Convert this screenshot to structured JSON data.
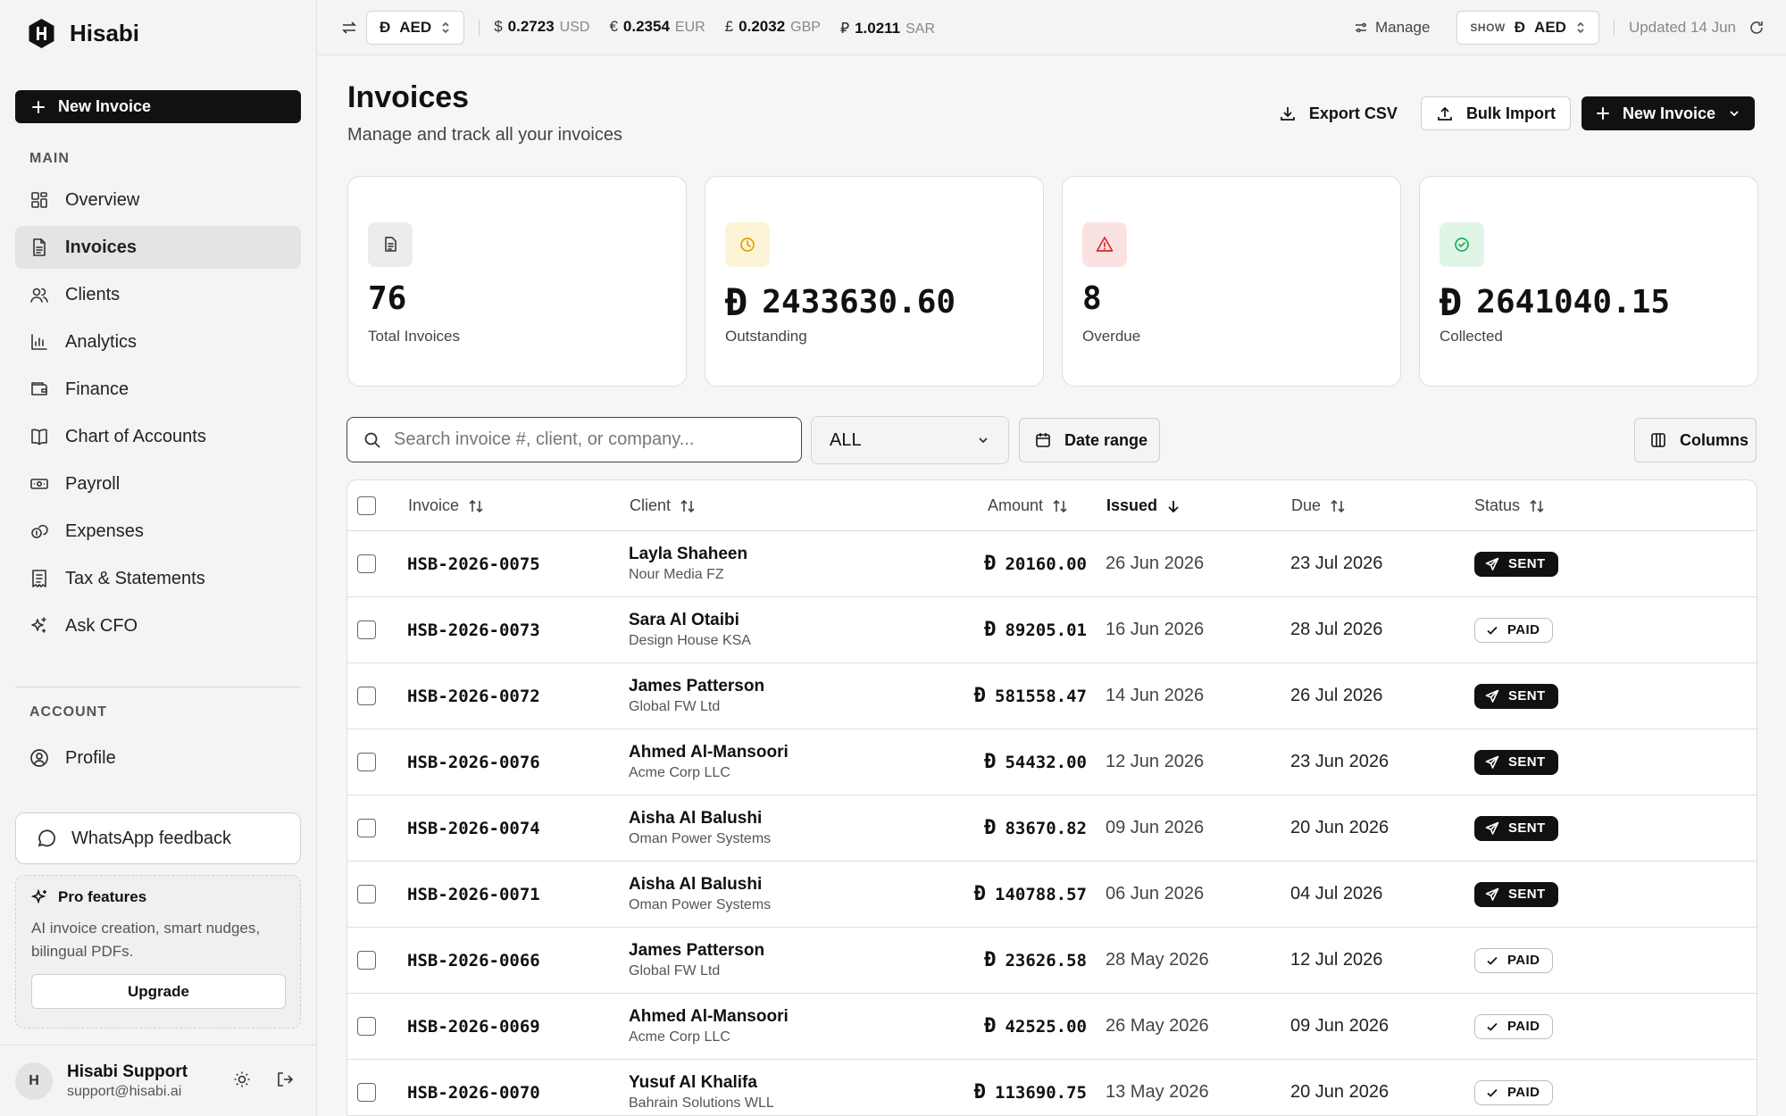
{
  "app": {
    "name": "Hisabi"
  },
  "sidebar": {
    "new_invoice": "New Invoice",
    "main_label": "MAIN",
    "account_label": "ACCOUNT",
    "items": [
      {
        "label": "Overview",
        "icon": "grid-icon"
      },
      {
        "label": "Invoices",
        "icon": "file-text-icon",
        "active": true
      },
      {
        "label": "Clients",
        "icon": "users-icon"
      },
      {
        "label": "Analytics",
        "icon": "bar-chart-icon"
      },
      {
        "label": "Finance",
        "icon": "wallet-icon"
      },
      {
        "label": "Chart of Accounts",
        "icon": "book-icon"
      },
      {
        "label": "Payroll",
        "icon": "banknote-icon"
      },
      {
        "label": "Expenses",
        "icon": "coins-icon"
      },
      {
        "label": "Tax & Statements",
        "icon": "receipt-icon"
      },
      {
        "label": "Ask CFO",
        "icon": "sparkles-icon"
      }
    ],
    "account_items": [
      {
        "label": "Profile",
        "icon": "user-circle-icon"
      }
    ],
    "whatsapp": "WhatsApp feedback",
    "pro": {
      "title": "Pro features",
      "text": "AI invoice creation, smart nudges, bilingual PDFs.",
      "upgrade": "Upgrade"
    },
    "user": {
      "initial": "H",
      "name": "Hisabi Support",
      "email": "support@hisabi.ai"
    }
  },
  "topbar": {
    "base_currency": "AED",
    "rates": [
      {
        "symbol": "$",
        "value": "0.2723",
        "code": "USD"
      },
      {
        "symbol": "€",
        "value": "0.2354",
        "code": "EUR"
      },
      {
        "symbol": "£",
        "value": "0.2032",
        "code": "GBP"
      },
      {
        "symbol": "⃁",
        "value": "1.0211",
        "code": "SAR"
      }
    ],
    "manage": "Manage",
    "show_label": "SHOW",
    "show_currency": "AED",
    "updated": "Updated 14 Jun"
  },
  "page": {
    "title": "Invoices",
    "subtitle": "Manage and track all your invoices",
    "export_csv": "Export CSV",
    "bulk_import": "Bulk Import",
    "new_invoice": "New Invoice"
  },
  "stats": [
    {
      "value": "76",
      "label": "Total Invoices",
      "icon": "document-icon",
      "currency": false,
      "bg": "#ececec",
      "fg": "#444444"
    },
    {
      "value": "2433630.60",
      "label": "Outstanding",
      "icon": "clock-icon",
      "currency": true,
      "bg": "#fdf3d6",
      "fg": "#d9a400"
    },
    {
      "value": "8",
      "label": "Overdue",
      "icon": "alert-triangle-icon",
      "currency": false,
      "bg": "#fbe2e2",
      "fg": "#d42b2b"
    },
    {
      "value": "2641040.15",
      "label": "Collected",
      "icon": "check-circle-icon",
      "currency": true,
      "bg": "#dff5e6",
      "fg": "#1fae56"
    }
  ],
  "filters": {
    "search_placeholder": "Search invoice #, client, or company...",
    "status": "ALL",
    "date_range": "Date range",
    "columns": "Columns"
  },
  "table": {
    "headers": {
      "invoice": "Invoice",
      "client": "Client",
      "amount": "Amount",
      "issued": "Issued",
      "due": "Due",
      "status": "Status"
    },
    "rows": [
      {
        "id": "HSB-2026-0075",
        "client": "Layla Shaheen",
        "company": "Nour Media FZ",
        "amount": "20160.00",
        "issued": "26 Jun 2026",
        "due": "23 Jul 2026",
        "status": "SENT"
      },
      {
        "id": "HSB-2026-0073",
        "client": "Sara Al Otaibi",
        "company": "Design House KSA",
        "amount": "89205.01",
        "issued": "16 Jun 2026",
        "due": "28 Jul 2026",
        "status": "PAID"
      },
      {
        "id": "HSB-2026-0072",
        "client": "James Patterson",
        "company": "Global FW Ltd",
        "amount": "581558.47",
        "issued": "14 Jun 2026",
        "due": "26 Jul 2026",
        "status": "SENT"
      },
      {
        "id": "HSB-2026-0076",
        "client": "Ahmed Al-Mansoori",
        "company": "Acme Corp LLC",
        "amount": "54432.00",
        "issued": "12 Jun 2026",
        "due": "23 Jun 2026",
        "status": "SENT"
      },
      {
        "id": "HSB-2026-0074",
        "client": "Aisha Al Balushi",
        "company": "Oman Power Systems",
        "amount": "83670.82",
        "issued": "09 Jun 2026",
        "due": "20 Jun 2026",
        "status": "SENT"
      },
      {
        "id": "HSB-2026-0071",
        "client": "Aisha Al Balushi",
        "company": "Oman Power Systems",
        "amount": "140788.57",
        "issued": "06 Jun 2026",
        "due": "04 Jul 2026",
        "status": "SENT"
      },
      {
        "id": "HSB-2026-0066",
        "client": "James Patterson",
        "company": "Global FW Ltd",
        "amount": "23626.58",
        "issued": "28 May 2026",
        "due": "12 Jul 2026",
        "status": "PAID"
      },
      {
        "id": "HSB-2026-0069",
        "client": "Ahmed Al-Mansoori",
        "company": "Acme Corp LLC",
        "amount": "42525.00",
        "issued": "26 May 2026",
        "due": "09 Jun 2026",
        "status": "PAID"
      },
      {
        "id": "HSB-2026-0070",
        "client": "Yusuf Al Khalifa",
        "company": "Bahrain Solutions WLL",
        "amount": "113690.75",
        "issued": "13 May 2026",
        "due": "20 Jun 2026",
        "status": "PAID"
      }
    ]
  }
}
